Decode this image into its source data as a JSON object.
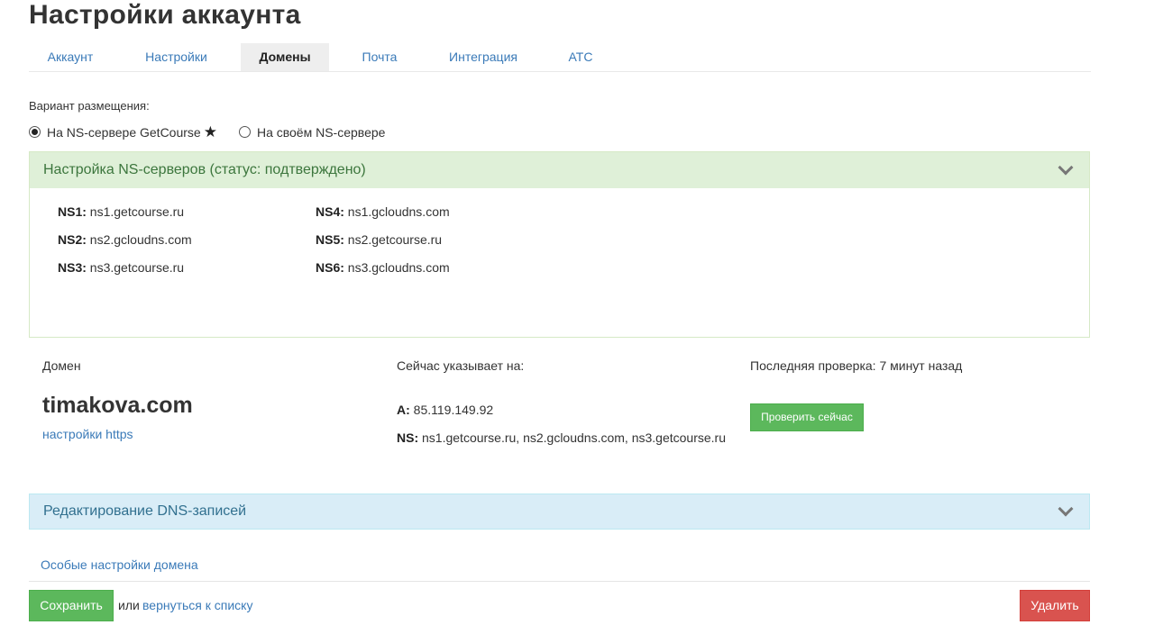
{
  "page": {
    "title": "Настройки аккаунта"
  },
  "tabs": [
    {
      "label": "Аккаунт",
      "active": false
    },
    {
      "label": "Настройки",
      "active": false
    },
    {
      "label": "Домены",
      "active": true
    },
    {
      "label": "Почта",
      "active": false
    },
    {
      "label": "Интеграция",
      "active": false
    },
    {
      "label": "АТС",
      "active": false
    }
  ],
  "placement": {
    "label": "Вариант размещения:",
    "options": [
      {
        "label": "На NS-сервере GetCourse",
        "checked": true,
        "star": "★"
      },
      {
        "label": "На своём NS-сервере",
        "checked": false
      }
    ]
  },
  "ns_panel": {
    "title": "Настройка NS-серверов (статус: подтверждено)",
    "servers": [
      {
        "key": "NS1:",
        "value": "ns1.getcourse.ru"
      },
      {
        "key": "NS2:",
        "value": "ns2.gcloudns.com"
      },
      {
        "key": "NS3:",
        "value": "ns3.getcourse.ru"
      },
      {
        "key": "NS4:",
        "value": "ns1.gcloudns.com"
      },
      {
        "key": "NS5:",
        "value": "ns2.getcourse.ru"
      },
      {
        "key": "NS6:",
        "value": "ns3.gcloudns.com"
      }
    ]
  },
  "domain": {
    "col_domain": "Домен",
    "col_points": "Сейчас указывает на:",
    "col_check": "Последняя проверка: 7 минут назад",
    "name": "timakova.com",
    "https_link": "настройки https",
    "a_key": "A:",
    "a_value": "85.119.149.92",
    "ns_key": "NS:",
    "ns_value": "ns1.getcourse.ru, ns2.gcloudns.com, ns3.getcourse.ru",
    "check_button": "Проверить сейчас"
  },
  "dns_panel": {
    "title": "Редактирование DNS-записей"
  },
  "special_link": "Особые настройки домена",
  "footer": {
    "save": "Сохранить",
    "or": "или",
    "back": "вернуться к списку",
    "delete": "Удалить"
  },
  "colors": {
    "link": "#3a7ab8",
    "success": "#5cb85c",
    "danger": "#d9534f",
    "panel_green": "#dff0d8",
    "panel_blue": "#d9edf7"
  }
}
